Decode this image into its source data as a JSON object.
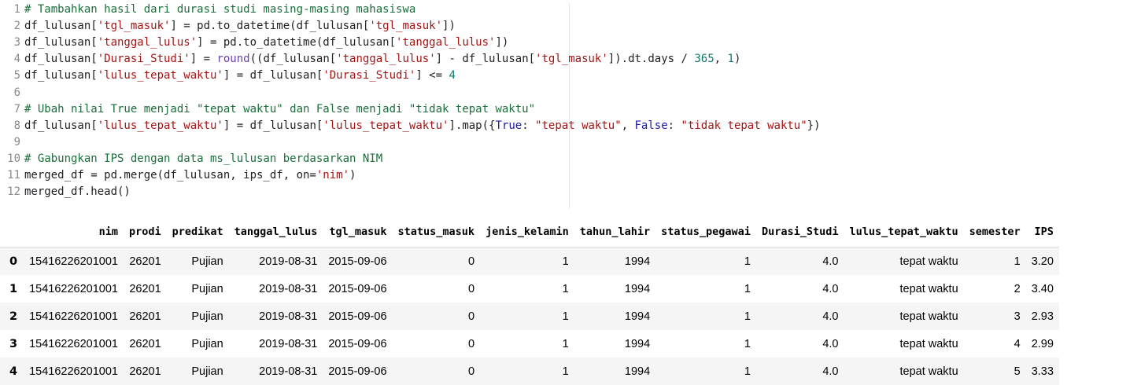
{
  "code_cell": {
    "lines": [
      [
        {
          "t": "comment",
          "v": "# Tambahkan hasil dari durasi studi masing-masing mahasiswa"
        }
      ],
      [
        {
          "t": "op",
          "v": "df_lulusan["
        },
        {
          "t": "string",
          "v": "'tgl_masuk'"
        },
        {
          "t": "op",
          "v": "] = pd.to_datetime(df_lulusan["
        },
        {
          "t": "string",
          "v": "'tgl_masuk'"
        },
        {
          "t": "op",
          "v": "])"
        }
      ],
      [
        {
          "t": "op",
          "v": "df_lulusan["
        },
        {
          "t": "string",
          "v": "'tanggal_lulus'"
        },
        {
          "t": "op",
          "v": "] = pd.to_datetime(df_lulusan["
        },
        {
          "t": "string",
          "v": "'tanggal_lulus'"
        },
        {
          "t": "op",
          "v": "])"
        }
      ],
      [
        {
          "t": "op",
          "v": "df_lulusan["
        },
        {
          "t": "string",
          "v": "'Durasi_Studi'"
        },
        {
          "t": "op",
          "v": "] = "
        },
        {
          "t": "fn",
          "v": "round"
        },
        {
          "t": "op",
          "v": "((df_lulusan["
        },
        {
          "t": "string",
          "v": "'tanggal_lulus'"
        },
        {
          "t": "op",
          "v": "] - df_lulusan["
        },
        {
          "t": "string",
          "v": "'tgl_masuk'"
        },
        {
          "t": "op",
          "v": "]).dt.days / "
        },
        {
          "t": "number",
          "v": "365"
        },
        {
          "t": "op",
          "v": ", "
        },
        {
          "t": "number",
          "v": "1"
        },
        {
          "t": "op",
          "v": ")"
        }
      ],
      [
        {
          "t": "op",
          "v": "df_lulusan["
        },
        {
          "t": "string",
          "v": "'lulus_tepat_waktu'"
        },
        {
          "t": "op",
          "v": "] = df_lulusan["
        },
        {
          "t": "string",
          "v": "'Durasi_Studi'"
        },
        {
          "t": "op",
          "v": "] <= "
        },
        {
          "t": "number",
          "v": "4"
        }
      ],
      [],
      [
        {
          "t": "comment",
          "v": "# Ubah nilai True menjadi \"tepat waktu\" dan False menjadi \"tidak tepat waktu\""
        }
      ],
      [
        {
          "t": "op",
          "v": "df_lulusan["
        },
        {
          "t": "string",
          "v": "'lulus_tepat_waktu'"
        },
        {
          "t": "op",
          "v": "] = df_lulusan["
        },
        {
          "t": "string",
          "v": "'lulus_tepat_waktu'"
        },
        {
          "t": "op",
          "v": "].map({"
        },
        {
          "t": "keyword",
          "v": "True"
        },
        {
          "t": "op",
          "v": ": "
        },
        {
          "t": "string",
          "v": "\"tepat waktu\""
        },
        {
          "t": "op",
          "v": ", "
        },
        {
          "t": "keyword",
          "v": "False"
        },
        {
          "t": "op",
          "v": ": "
        },
        {
          "t": "string",
          "v": "\"tidak tepat waktu\""
        },
        {
          "t": "op",
          "v": "})"
        }
      ],
      [],
      [
        {
          "t": "comment",
          "v": "# Gabungkan IPS dengan data ms_lulusan berdasarkan NIM"
        }
      ],
      [
        {
          "t": "op",
          "v": "merged_df = pd.merge(df_lulusan, ips_df, on="
        },
        {
          "t": "string",
          "v": "'nim'"
        },
        {
          "t": "op",
          "v": ")"
        }
      ],
      [
        {
          "t": "op",
          "v": "merged_df.head()"
        }
      ]
    ]
  },
  "output_table": {
    "columns": [
      "nim",
      "prodi",
      "predikat",
      "tanggal_lulus",
      "tgl_masuk",
      "status_masuk",
      "jenis_kelamin",
      "tahun_lahir",
      "status_pegawai",
      "Durasi_Studi",
      "lulus_tepat_waktu",
      "semester",
      "IPS"
    ],
    "rows": [
      {
        "index": "0",
        "cells": [
          "15416226201001",
          "26201",
          "Pujian",
          "2019-08-31",
          "2015-09-06",
          "0",
          "1",
          "1994",
          "1",
          "4.0",
          "tepat waktu",
          "1",
          "3.20"
        ]
      },
      {
        "index": "1",
        "cells": [
          "15416226201001",
          "26201",
          "Pujian",
          "2019-08-31",
          "2015-09-06",
          "0",
          "1",
          "1994",
          "1",
          "4.0",
          "tepat waktu",
          "2",
          "3.40"
        ]
      },
      {
        "index": "2",
        "cells": [
          "15416226201001",
          "26201",
          "Pujian",
          "2019-08-31",
          "2015-09-06",
          "0",
          "1",
          "1994",
          "1",
          "4.0",
          "tepat waktu",
          "3",
          "2.93"
        ]
      },
      {
        "index": "3",
        "cells": [
          "15416226201001",
          "26201",
          "Pujian",
          "2019-08-31",
          "2015-09-06",
          "0",
          "1",
          "1994",
          "1",
          "4.0",
          "tepat waktu",
          "4",
          "2.99"
        ]
      },
      {
        "index": "4",
        "cells": [
          "15416226201001",
          "26201",
          "Pujian",
          "2019-08-31",
          "2015-09-06",
          "0",
          "1",
          "1994",
          "1",
          "4.0",
          "tepat waktu",
          "5",
          "3.33"
        ]
      }
    ]
  },
  "colors": {
    "comment": "#1a6e3a",
    "string": "#a31515",
    "number": "#0b7a6f",
    "keyword": "#1a1aa6",
    "row_stripe": "#f5f5f5"
  }
}
